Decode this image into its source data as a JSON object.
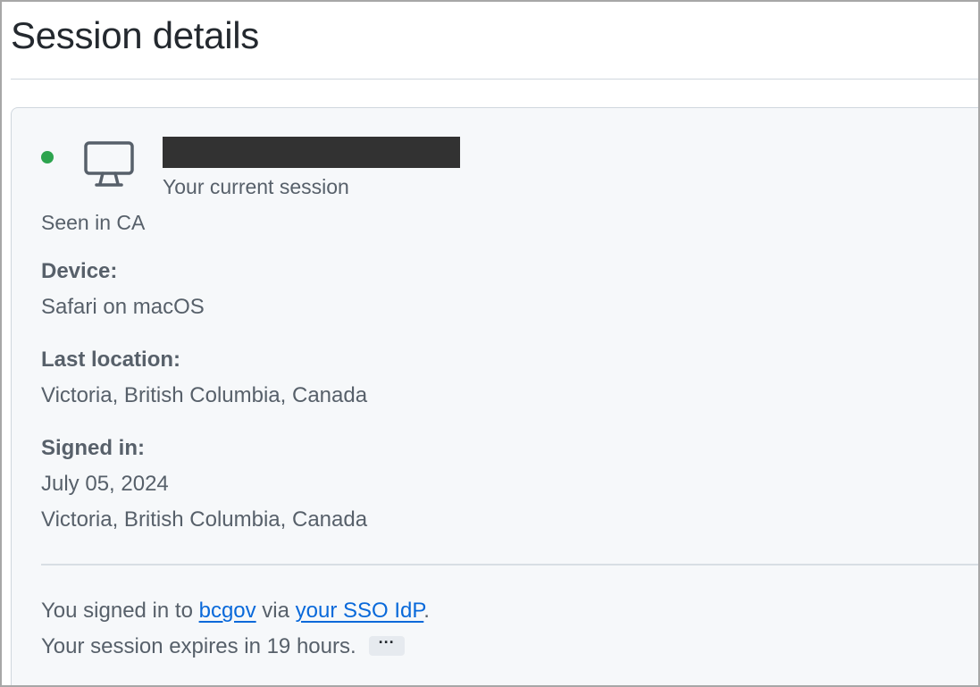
{
  "page": {
    "title": "Session details"
  },
  "session": {
    "status_color": "#2da44e",
    "device_icon": "desktop-computer-icon",
    "current_session_text": "Your current session",
    "seen_in": "Seen in CA",
    "device_label": "Device:",
    "device_value": "Safari on macOS",
    "last_location_label": "Last location:",
    "last_location_value": "Victoria, British Columbia, Canada",
    "signed_in_label": "Signed in:",
    "signed_in_date": "July 05, 2024",
    "signed_in_location": "Victoria, British Columbia, Canada"
  },
  "footer": {
    "signed_in_prefix": "You signed in to ",
    "org_link": "bcgov",
    "via_text": " via ",
    "sso_link": "your SSO IdP",
    "period": ".",
    "expires_text": "Your session expires in 19 hours.",
    "more_label": "···"
  }
}
